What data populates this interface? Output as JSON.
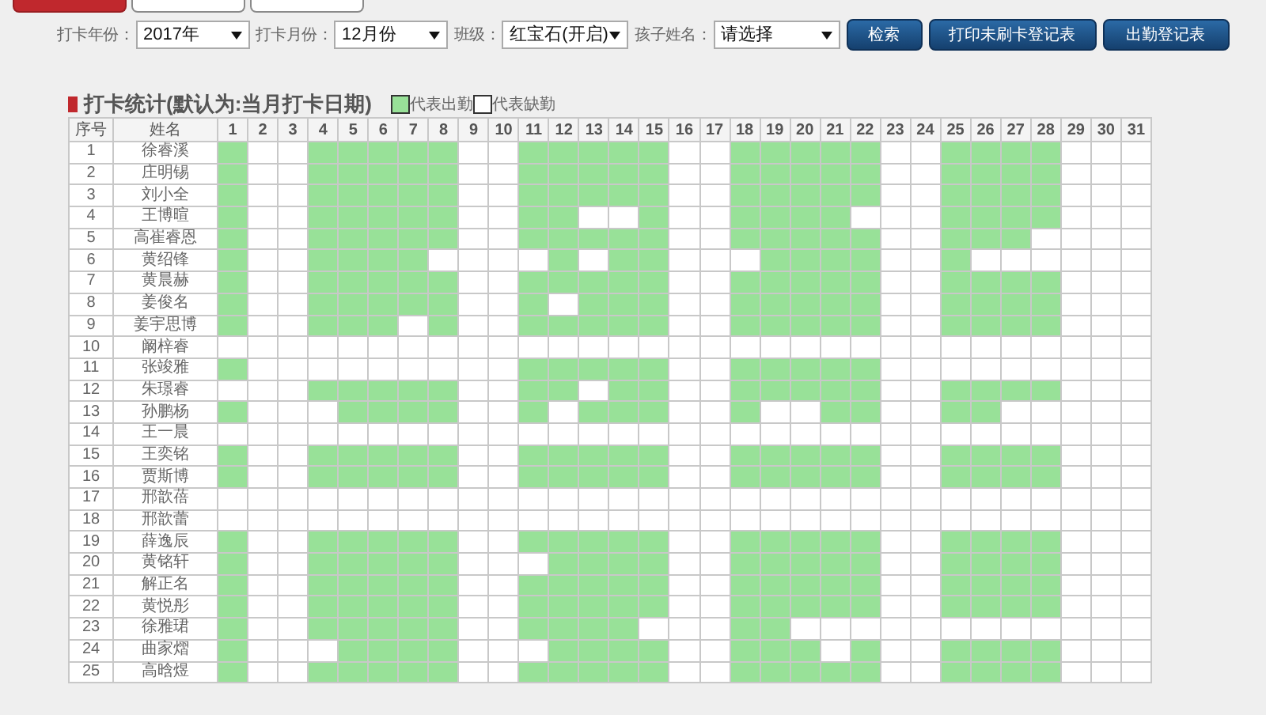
{
  "tabs": [
    {
      "selected": true
    },
    {
      "selected": false
    },
    {
      "selected": false
    }
  ],
  "filters": [
    {
      "label": "打卡年份：",
      "value": "2017年"
    },
    {
      "label": "打卡月份：",
      "value": "12月份"
    },
    {
      "label": "班级：",
      "value": "红宝石(开启)"
    },
    {
      "label": "孩子姓名：",
      "value": "请选择"
    }
  ],
  "buttons": [
    "检索",
    "打印未刷卡登记表",
    "出勤登记表"
  ],
  "section": {
    "title": "打卡统计(默认为:当月打卡日期)"
  },
  "legend": [
    {
      "kind": "present",
      "label": "代表出勤"
    },
    {
      "kind": "absent",
      "label": "代表缺勤"
    }
  ],
  "table": {
    "columns": [
      "序号",
      "姓名",
      "1",
      "2",
      "3",
      "4",
      "5",
      "6",
      "7",
      "8",
      "9",
      "10",
      "11",
      "12",
      "13",
      "14",
      "15",
      "16",
      "17",
      "18",
      "19",
      "20",
      "21",
      "22",
      "23",
      "24",
      "25",
      "26",
      "27",
      "28",
      "29",
      "30",
      "31"
    ],
    "rows": [
      {
        "no": "1",
        "name": "徐睿溪",
        "days": [
          true,
          false,
          false,
          true,
          true,
          true,
          true,
          true,
          false,
          false,
          true,
          true,
          true,
          true,
          true,
          false,
          false,
          true,
          true,
          true,
          true,
          true,
          false,
          false,
          true,
          true,
          true,
          true,
          false,
          false,
          false
        ]
      },
      {
        "no": "2",
        "name": "庄明锡",
        "days": [
          true,
          false,
          false,
          true,
          true,
          true,
          true,
          true,
          false,
          false,
          true,
          true,
          true,
          true,
          true,
          false,
          false,
          true,
          true,
          true,
          true,
          true,
          false,
          false,
          true,
          true,
          true,
          true,
          false,
          false,
          false
        ]
      },
      {
        "no": "3",
        "name": "刘小全",
        "days": [
          true,
          false,
          false,
          true,
          true,
          true,
          true,
          true,
          false,
          false,
          true,
          true,
          true,
          true,
          true,
          false,
          false,
          true,
          true,
          true,
          true,
          true,
          false,
          false,
          true,
          true,
          true,
          true,
          false,
          false,
          false
        ]
      },
      {
        "no": "4",
        "name": "王博暄",
        "days": [
          true,
          false,
          false,
          true,
          true,
          true,
          true,
          true,
          false,
          false,
          true,
          true,
          false,
          false,
          true,
          false,
          false,
          true,
          true,
          true,
          true,
          false,
          false,
          false,
          true,
          true,
          true,
          true,
          false,
          false,
          false
        ]
      },
      {
        "no": "5",
        "name": "高崔睿恩",
        "days": [
          true,
          false,
          false,
          true,
          true,
          true,
          true,
          true,
          false,
          false,
          true,
          true,
          true,
          true,
          true,
          false,
          false,
          true,
          true,
          true,
          true,
          true,
          false,
          false,
          true,
          true,
          true,
          false,
          false,
          false,
          false
        ]
      },
      {
        "no": "6",
        "name": "黄绍锋",
        "days": [
          true,
          false,
          false,
          true,
          true,
          true,
          true,
          false,
          false,
          false,
          false,
          true,
          false,
          true,
          true,
          false,
          false,
          false,
          true,
          true,
          true,
          true,
          false,
          false,
          true,
          false,
          false,
          false,
          false,
          false,
          false
        ]
      },
      {
        "no": "7",
        "name": "黄晨赫",
        "days": [
          true,
          false,
          false,
          true,
          true,
          true,
          true,
          true,
          false,
          false,
          true,
          true,
          true,
          true,
          true,
          false,
          false,
          true,
          true,
          true,
          true,
          true,
          false,
          false,
          true,
          true,
          true,
          true,
          false,
          false,
          false
        ]
      },
      {
        "no": "8",
        "name": "姜俊名",
        "days": [
          true,
          false,
          false,
          true,
          true,
          true,
          true,
          true,
          false,
          false,
          true,
          false,
          true,
          true,
          true,
          false,
          false,
          true,
          true,
          true,
          true,
          true,
          false,
          false,
          true,
          true,
          true,
          true,
          false,
          false,
          false
        ]
      },
      {
        "no": "9",
        "name": "姜宇思博",
        "days": [
          true,
          false,
          false,
          true,
          true,
          true,
          false,
          true,
          false,
          false,
          true,
          true,
          true,
          true,
          true,
          false,
          false,
          true,
          true,
          true,
          true,
          true,
          false,
          false,
          true,
          true,
          true,
          true,
          false,
          false,
          false
        ]
      },
      {
        "no": "10",
        "name": "阚梓睿",
        "days": [
          false,
          false,
          false,
          false,
          false,
          false,
          false,
          false,
          false,
          false,
          false,
          false,
          false,
          false,
          false,
          false,
          false,
          false,
          false,
          false,
          false,
          false,
          false,
          false,
          false,
          false,
          false,
          false,
          false,
          false,
          false
        ]
      },
      {
        "no": "11",
        "name": "张竣雅",
        "days": [
          true,
          false,
          false,
          false,
          false,
          false,
          false,
          false,
          false,
          false,
          true,
          true,
          true,
          true,
          true,
          false,
          false,
          true,
          true,
          true,
          true,
          true,
          false,
          false,
          false,
          false,
          false,
          false,
          false,
          false,
          false
        ]
      },
      {
        "no": "12",
        "name": "朱璟睿",
        "days": [
          false,
          false,
          false,
          true,
          true,
          true,
          true,
          true,
          false,
          false,
          true,
          true,
          false,
          true,
          true,
          false,
          false,
          true,
          true,
          true,
          true,
          true,
          false,
          false,
          true,
          true,
          true,
          true,
          false,
          false,
          false
        ]
      },
      {
        "no": "13",
        "name": "孙鹏杨",
        "days": [
          true,
          false,
          false,
          false,
          true,
          true,
          true,
          true,
          false,
          false,
          true,
          false,
          true,
          true,
          true,
          false,
          false,
          true,
          false,
          false,
          true,
          true,
          false,
          false,
          true,
          true,
          false,
          false,
          false,
          false,
          false
        ]
      },
      {
        "no": "14",
        "name": "王一晨",
        "days": [
          false,
          false,
          false,
          false,
          false,
          false,
          false,
          false,
          false,
          false,
          false,
          false,
          false,
          false,
          false,
          false,
          false,
          false,
          false,
          false,
          false,
          false,
          false,
          false,
          false,
          false,
          false,
          false,
          false,
          false,
          false
        ]
      },
      {
        "no": "15",
        "name": "王奕铭",
        "days": [
          true,
          false,
          false,
          true,
          true,
          true,
          true,
          true,
          false,
          false,
          true,
          true,
          true,
          true,
          true,
          false,
          false,
          true,
          true,
          true,
          true,
          true,
          false,
          false,
          true,
          true,
          true,
          true,
          false,
          false,
          false
        ]
      },
      {
        "no": "16",
        "name": "贾斯博",
        "days": [
          true,
          false,
          false,
          true,
          true,
          true,
          true,
          true,
          false,
          false,
          true,
          true,
          true,
          true,
          true,
          false,
          false,
          true,
          true,
          true,
          true,
          true,
          false,
          false,
          true,
          true,
          true,
          true,
          false,
          false,
          false
        ]
      },
      {
        "no": "17",
        "name": "邢歆蓓",
        "days": [
          false,
          false,
          false,
          false,
          false,
          false,
          false,
          false,
          false,
          false,
          false,
          false,
          false,
          false,
          false,
          false,
          false,
          false,
          false,
          false,
          false,
          false,
          false,
          false,
          false,
          false,
          false,
          false,
          false,
          false,
          false
        ]
      },
      {
        "no": "18",
        "name": "邢歆蕾",
        "days": [
          false,
          false,
          false,
          false,
          false,
          false,
          false,
          false,
          false,
          false,
          false,
          false,
          false,
          false,
          false,
          false,
          false,
          false,
          false,
          false,
          false,
          false,
          false,
          false,
          false,
          false,
          false,
          false,
          false,
          false,
          false
        ]
      },
      {
        "no": "19",
        "name": "薛逸辰",
        "days": [
          true,
          false,
          false,
          true,
          true,
          true,
          true,
          true,
          false,
          false,
          true,
          true,
          true,
          true,
          true,
          false,
          false,
          true,
          true,
          true,
          true,
          true,
          false,
          false,
          true,
          true,
          true,
          true,
          false,
          false,
          false
        ]
      },
      {
        "no": "20",
        "name": "黄铭轩",
        "days": [
          true,
          false,
          false,
          true,
          true,
          true,
          true,
          true,
          false,
          false,
          false,
          true,
          true,
          true,
          true,
          false,
          false,
          true,
          true,
          true,
          true,
          true,
          false,
          false,
          true,
          true,
          true,
          true,
          false,
          false,
          false
        ]
      },
      {
        "no": "21",
        "name": "解正名",
        "days": [
          true,
          false,
          false,
          true,
          true,
          true,
          true,
          true,
          false,
          false,
          true,
          true,
          true,
          true,
          true,
          false,
          false,
          true,
          true,
          true,
          true,
          true,
          false,
          false,
          true,
          true,
          true,
          true,
          false,
          false,
          false
        ]
      },
      {
        "no": "22",
        "name": "黄悦彤",
        "days": [
          true,
          false,
          false,
          true,
          true,
          true,
          true,
          true,
          false,
          false,
          true,
          true,
          true,
          true,
          true,
          false,
          false,
          true,
          true,
          true,
          true,
          true,
          false,
          false,
          true,
          true,
          true,
          true,
          false,
          false,
          false
        ]
      },
      {
        "no": "23",
        "name": "徐雅珺",
        "days": [
          true,
          false,
          false,
          true,
          true,
          true,
          true,
          true,
          false,
          false,
          true,
          true,
          true,
          true,
          false,
          false,
          false,
          true,
          true,
          false,
          false,
          false,
          false,
          false,
          false,
          false,
          false,
          false,
          false,
          false,
          false
        ]
      },
      {
        "no": "24",
        "name": "曲家熠",
        "days": [
          true,
          false,
          false,
          false,
          true,
          true,
          true,
          true,
          false,
          false,
          false,
          true,
          true,
          true,
          true,
          false,
          false,
          true,
          true,
          true,
          false,
          true,
          false,
          false,
          true,
          true,
          true,
          true,
          false,
          false,
          false
        ]
      },
      {
        "no": "25",
        "name": "高晗煜",
        "days": [
          true,
          false,
          false,
          true,
          true,
          true,
          true,
          true,
          false,
          false,
          true,
          true,
          true,
          true,
          true,
          false,
          false,
          true,
          true,
          true,
          true,
          true,
          false,
          false,
          true,
          true,
          true,
          true,
          false,
          false,
          false
        ]
      }
    ]
  }
}
